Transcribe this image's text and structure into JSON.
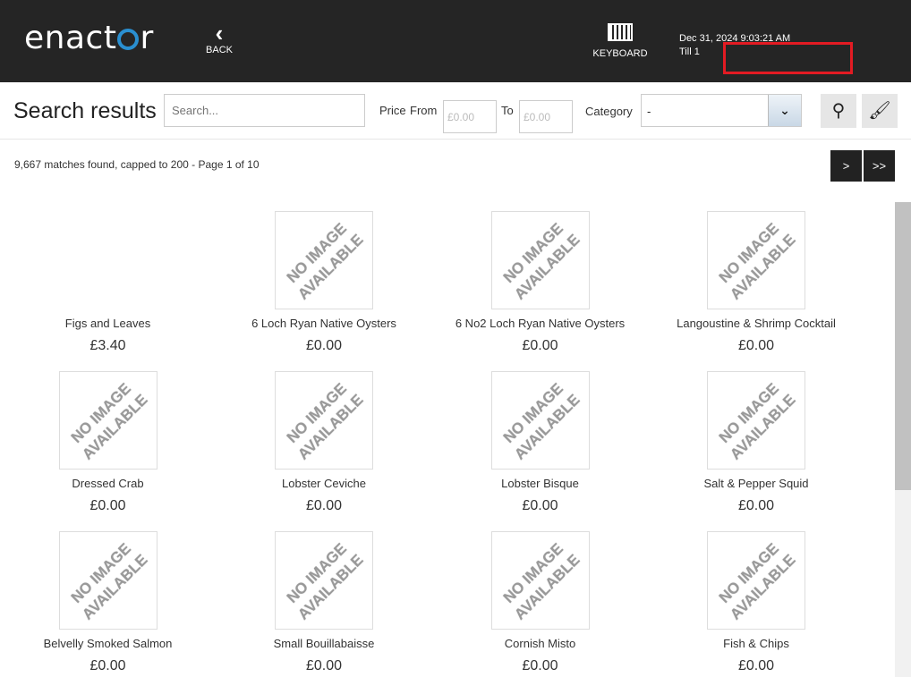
{
  "header": {
    "logo": "enactor",
    "back_label": "BACK",
    "keyboard_label": "KEYBOARD",
    "datetime": "Dec 31, 2024 9:03:21 AM",
    "till": "Till 1"
  },
  "toolbar": {
    "title": "Search results",
    "search_placeholder": "Search...",
    "price_label": "Price",
    "from_label": "From",
    "to_label": "To",
    "price_from_placeholder": "£0.00",
    "price_to_placeholder": "£0.00",
    "category_label": "Category",
    "category_value": "-"
  },
  "results": {
    "summary": "9,667 matches found, capped to 200 - Page 1 of 10",
    "next_label": ">",
    "last_label": ">>"
  },
  "placeholder_text": "NO IMAGE AVAILABLE",
  "products": [
    {
      "name": "Figs and Leaves",
      "price": "£3.40",
      "has_image": true
    },
    {
      "name": "6 Loch Ryan Native Oysters",
      "price": "£0.00"
    },
    {
      "name": "6 No2 Loch Ryan Native Oysters",
      "price": "£0.00"
    },
    {
      "name": "Langoustine & Shrimp Cocktail",
      "price": "£0.00"
    },
    {
      "name": "Dressed Crab",
      "price": "£0.00"
    },
    {
      "name": "Lobster Ceviche",
      "price": "£0.00"
    },
    {
      "name": "Lobster Bisque",
      "price": "£0.00"
    },
    {
      "name": "Salt & Pepper Squid",
      "price": "£0.00"
    },
    {
      "name": "Belvelly Smoked Salmon",
      "price": "£0.00"
    },
    {
      "name": "Small Bouillabaisse",
      "price": "£0.00"
    },
    {
      "name": "Cornish Misto",
      "price": "£0.00"
    },
    {
      "name": "Fish & Chips",
      "price": "£0.00"
    }
  ]
}
